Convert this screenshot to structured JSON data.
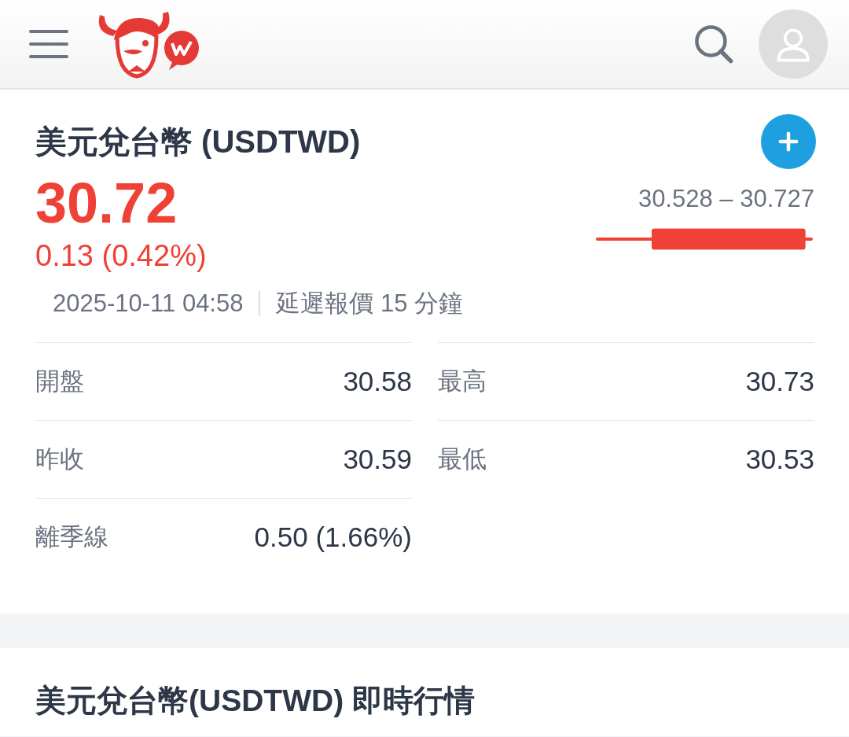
{
  "quote": {
    "title": "美元兌台幣 (USDTWD)",
    "price": "30.72",
    "change": "0.13 (0.42%)",
    "rising": true,
    "range": "30.528 – 30.727",
    "timestamp": "2025-10-11 04:58",
    "delay_note": "延遲報價 15 分鐘"
  },
  "stats": {
    "left": [
      {
        "label": "開盤",
        "value": "30.58"
      },
      {
        "label": "昨收",
        "value": "30.59"
      },
      {
        "label": "離季線",
        "value": "0.50 (1.66%)"
      }
    ],
    "right": [
      {
        "label": "最高",
        "value": "30.73"
      },
      {
        "label": "最低",
        "value": "30.53"
      }
    ]
  },
  "section": {
    "title": "美元兌台幣(USDTWD) 即時行情"
  }
}
